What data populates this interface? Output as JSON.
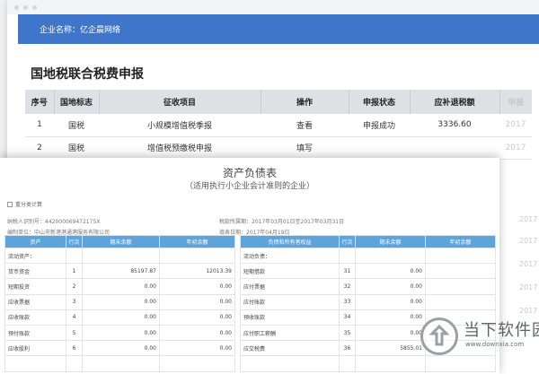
{
  "company_bar": {
    "text": "企业名称：亿企晨网络"
  },
  "page_heading": "国地税联合税费申报",
  "tax_table": {
    "headers": [
      "序号",
      "国地标志",
      "征收项目",
      "操作",
      "申报状态",
      "应补退税额",
      "申报"
    ],
    "rows": [
      [
        "1",
        "国税",
        "小规模增值税季报",
        "查看",
        "申报成功",
        "3336.60",
        "2017"
      ],
      [
        "2",
        "国税",
        "增值税预缴税申报",
        "填写",
        "",
        "",
        "2017"
      ]
    ],
    "side_faded": [
      "2017",
      "2017",
      "2017",
      "2017",
      "2017"
    ]
  },
  "sheet": {
    "title": "资产负债表",
    "subtitle": "（适用执行小企业会计准则的企业）",
    "recalc_label": "重分类计算",
    "taxpayer_id": "纳税人识别号：44200006947217​5X",
    "period": "税款所属期：2017年03月01日至2017年03月31日",
    "unit": "编制单位：中山市新港港通港服务有限公司",
    "fill_date": "填表日期：2017年04月19日",
    "headers": [
      "资产",
      "行次",
      "期末余额",
      "年初余额",
      "负债和所有者权益",
      "行次",
      "期末余额",
      "年初余额"
    ],
    "rows": [
      [
        "流动资产：",
        "",
        "",
        "",
        "流动负债：",
        "",
        "",
        ""
      ],
      [
        "货币资金",
        "1",
        "85197.87",
        "12013.39",
        "短期借款",
        "31",
        "0.00",
        ""
      ],
      [
        "短期投资",
        "2",
        "0.00",
        "0.00",
        "应付票据",
        "32",
        "0.00",
        ""
      ],
      [
        "应收票据",
        "3",
        "0.00",
        "0.00",
        "应付账款",
        "33",
        "0.00",
        ""
      ],
      [
        "应收账款",
        "4",
        "0.00",
        "0.00",
        "预收账款",
        "34",
        "0.00",
        ""
      ],
      [
        "预付账款",
        "5",
        "0.00",
        "0.00",
        "应付职工薪酬",
        "35",
        "0.00",
        ""
      ],
      [
        "应收股利",
        "6",
        "0.00",
        "0.00",
        "应交税费",
        "36",
        "5855.01",
        ""
      ],
      [
        "",
        "",
        "",
        "",
        "",
        "",
        "",
        ""
      ]
    ]
  },
  "watermark": {
    "main": "当下软件园",
    "url": "www.downxia.com"
  },
  "colors": {
    "company_bar": "#3f76c9",
    "sheet_header": "#5fa3db",
    "table_header": "#dde0e5"
  }
}
